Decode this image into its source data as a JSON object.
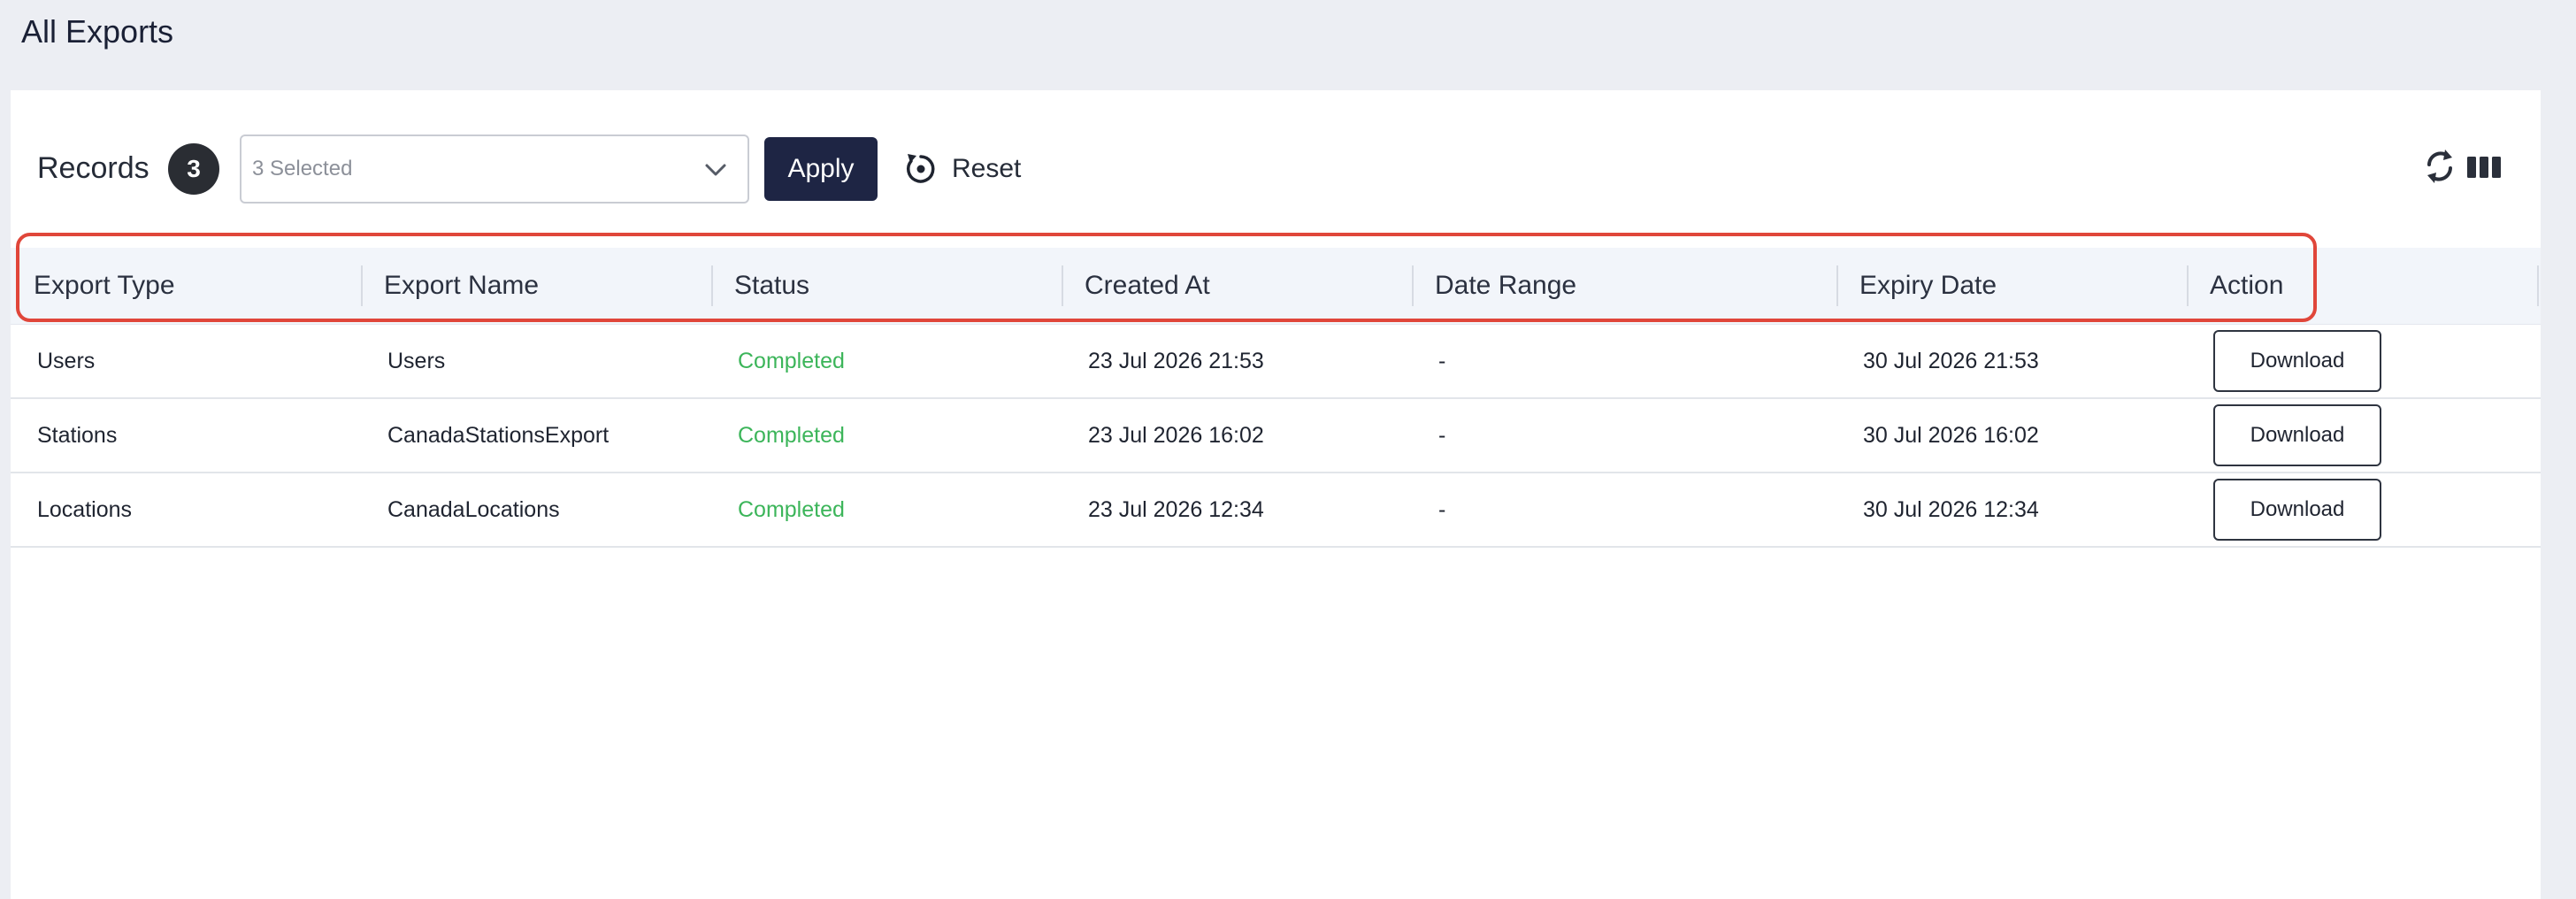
{
  "page": {
    "title": "All Exports"
  },
  "toolbar": {
    "records_label": "Records",
    "records_count": "3",
    "selector_value": "3 Selected",
    "apply_label": "Apply",
    "reset_label": "Reset",
    "icons": {
      "chevron": "chevron-down-icon",
      "reset": "reset-icon",
      "refresh": "refresh-icon",
      "columns": "columns-icon"
    }
  },
  "table": {
    "headers": [
      "Export Type",
      "Export Name",
      "Status",
      "Created At",
      "Date Range",
      "Expiry Date",
      "Action"
    ],
    "rows": [
      {
        "export_type": "Users",
        "export_name": "Users",
        "status": "Completed",
        "created_at": "23 Jul 2026 21:53",
        "date_range": "-",
        "expiry_date": "30 Jul 2026 21:53",
        "action": "Download"
      },
      {
        "export_type": "Stations",
        "export_name": "CanadaStationsExport",
        "status": "Completed",
        "created_at": "23 Jul 2026 16:02",
        "date_range": "-",
        "expiry_date": "30 Jul 2026 16:02",
        "action": "Download"
      },
      {
        "export_type": "Locations",
        "export_name": "CanadaLocations",
        "status": "Completed",
        "created_at": "23 Jul 2026 12:34",
        "date_range": "-",
        "expiry_date": "30 Jul 2026 12:34",
        "action": "Download"
      }
    ]
  },
  "colors": {
    "background": "#eceef3",
    "card": "#ffffff",
    "primary_button": "#1e2544",
    "status_completed": "#3cb55a",
    "highlight": "#e0463a",
    "header_row": "#f2f5fa"
  }
}
